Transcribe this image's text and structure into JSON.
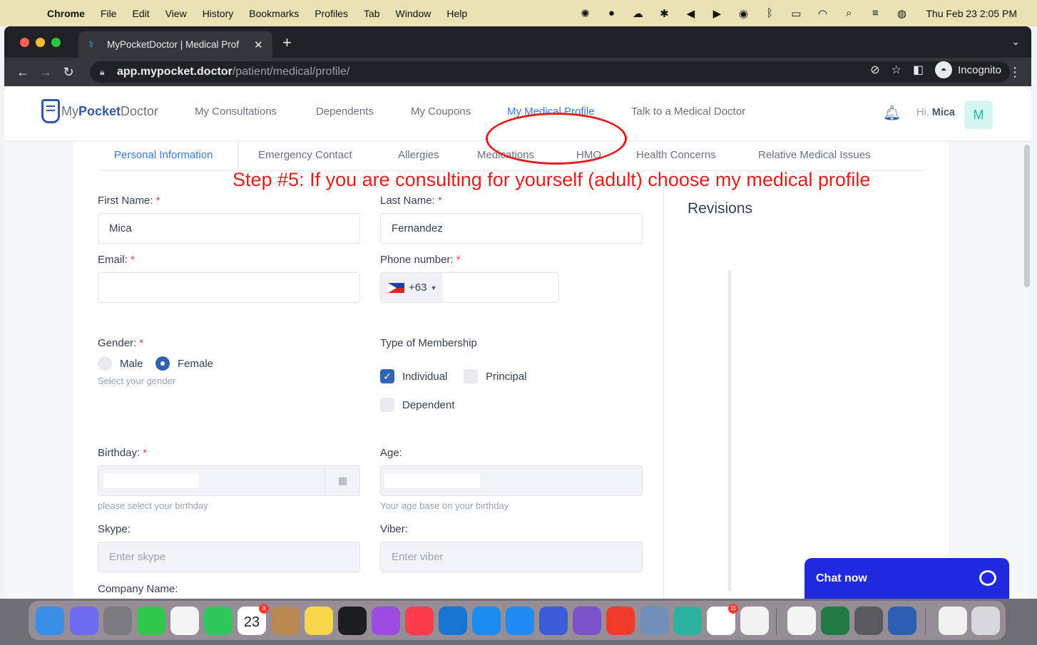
{
  "menubar": {
    "app_name": "Chrome",
    "menus": [
      "File",
      "Edit",
      "View",
      "History",
      "Bookmarks",
      "Profiles",
      "Tab",
      "Window",
      "Help"
    ],
    "clock": "Thu Feb 23  2:05 PM"
  },
  "browser": {
    "tab_title": "MyPocketDoctor | Medical Prof",
    "url_host": "app.mypocket.doctor",
    "url_path": "/patient/medical/profile/",
    "profile_label": "Incognito"
  },
  "header": {
    "logo": {
      "my": "My",
      "pocket": "Pocket",
      "doctor": "Doctor"
    },
    "nav": [
      {
        "label": "My Consultations"
      },
      {
        "label": "Dependents"
      },
      {
        "label": "My Coupons"
      },
      {
        "label": "My Medical Profile",
        "active": true
      },
      {
        "label": "Talk to a Medical Doctor"
      }
    ],
    "greeting_prefix": "Hi, ",
    "user_name": "Mica",
    "avatar_letter": "M"
  },
  "profile_tabs": [
    {
      "label": "Personal Information",
      "active": true
    },
    {
      "label": "Emergency Contact"
    },
    {
      "label": "Allergies"
    },
    {
      "label": "Medications"
    },
    {
      "label": "HMO"
    },
    {
      "label": "Health Concerns"
    },
    {
      "label": "Relative Medical Issues"
    }
  ],
  "annotation": {
    "step_text": "Step #5: If you are consulting for yourself (adult) choose my medical profile"
  },
  "form": {
    "required_mark": "*",
    "first_name": {
      "label": "First Name:",
      "value": "Mica"
    },
    "last_name": {
      "label": "Last Name:",
      "value": "Fernandez"
    },
    "email": {
      "label": "Email:",
      "value": ""
    },
    "phone": {
      "label": "Phone number:",
      "dial_code": "+63"
    },
    "gender": {
      "label": "Gender:",
      "options": [
        "Male",
        "Female"
      ],
      "selected": "Female",
      "help": "Select your gender"
    },
    "membership": {
      "label": "Type of Membership",
      "options": [
        "Individual",
        "Principal",
        "Dependent"
      ],
      "checked": "Individual"
    },
    "birthday": {
      "label": "Birthday:",
      "help": "please select your birthday"
    },
    "age": {
      "label": "Age:",
      "help": "Your age base on your birthday"
    },
    "skype": {
      "label": "Skype:",
      "placeholder": "Enter skype"
    },
    "viber": {
      "label": "Viber:",
      "placeholder": "Enter viber"
    },
    "company": {
      "label": "Company Name:"
    }
  },
  "revisions": {
    "title": "Revisions"
  },
  "chat": {
    "label": "Chat now"
  },
  "colors": {
    "accent_blue": "#3b7ad9",
    "annotation_red": "#e0201a",
    "chat_blue": "#1f29e0",
    "menubar_bg": "#e9e2b4"
  },
  "dock": {
    "calendar_month": "FEB",
    "calendar_day": "23",
    "calendar_badge": "3",
    "reminders_badge": "11"
  }
}
